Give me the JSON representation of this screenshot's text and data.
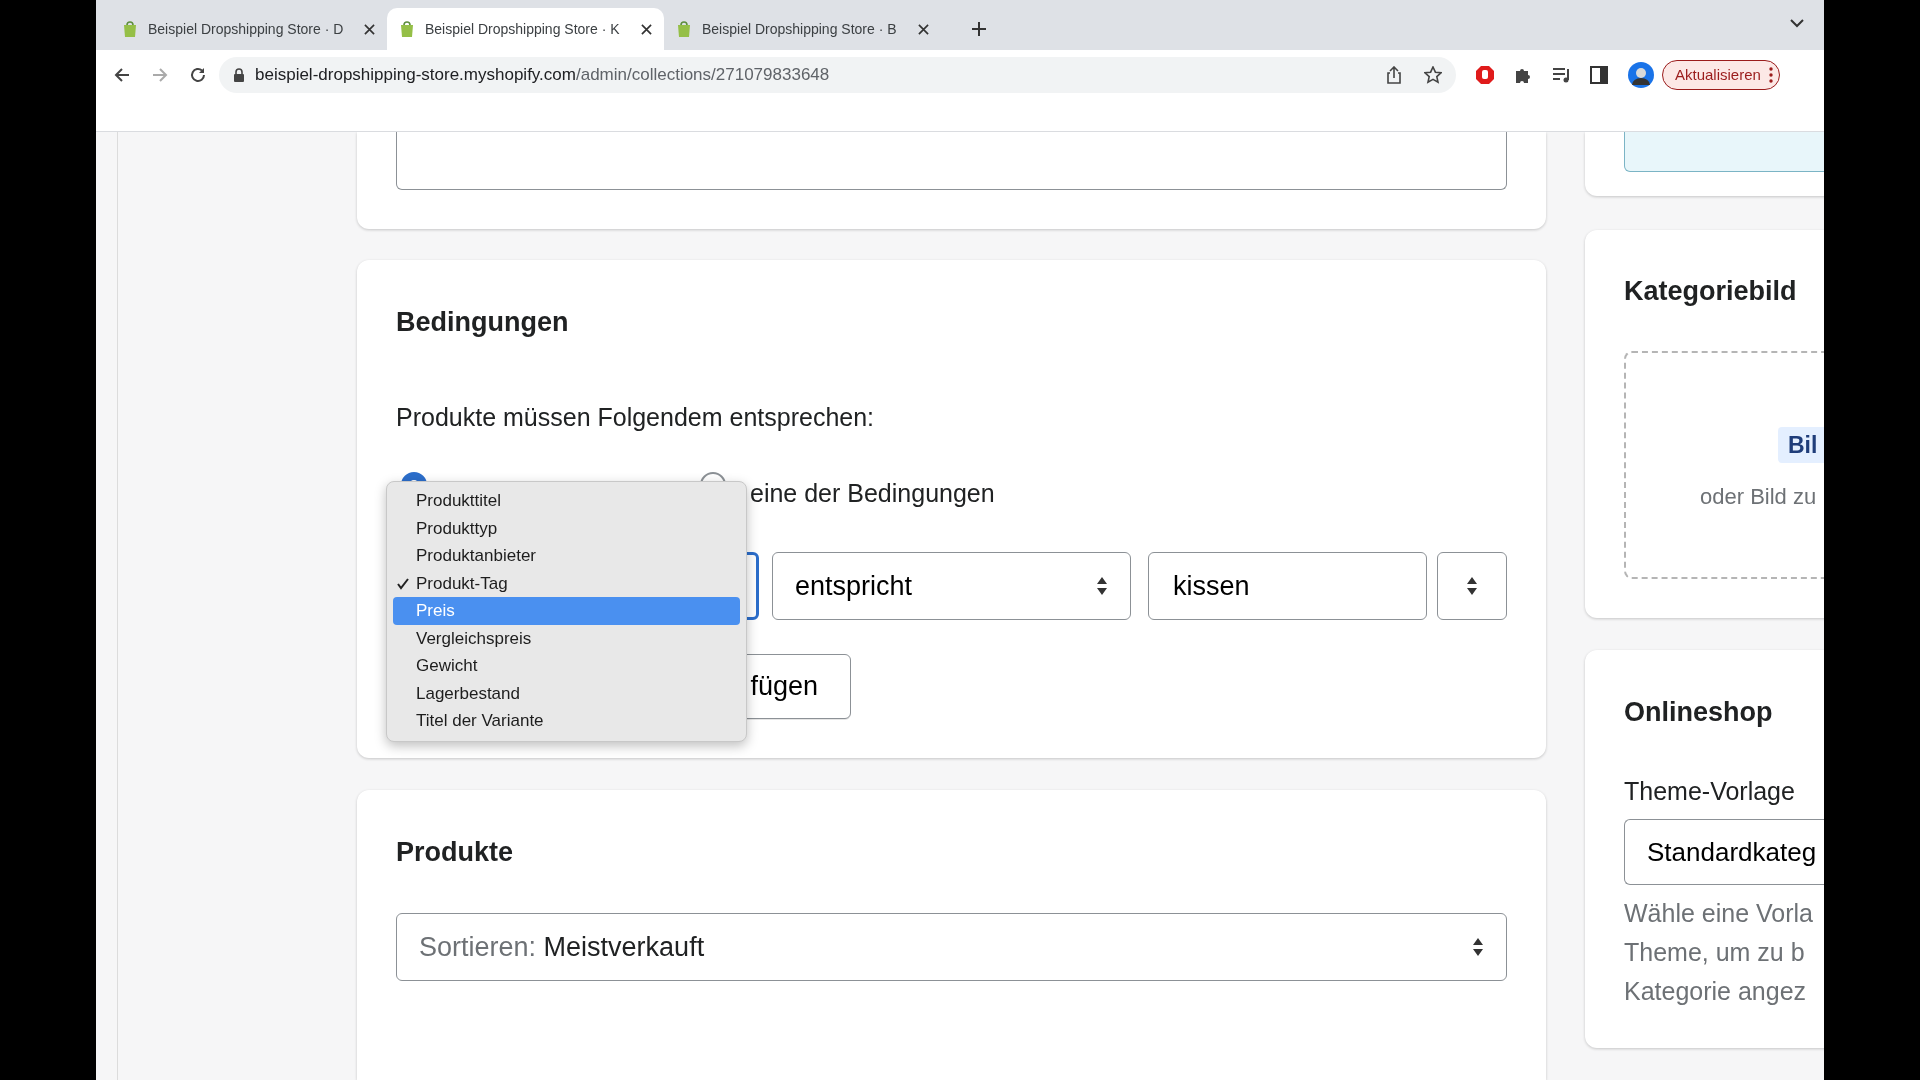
{
  "browser": {
    "tabs": [
      {
        "title": "Beispiel Dropshipping Store · D",
        "selected": false
      },
      {
        "title": "Beispiel Dropshipping Store · K",
        "selected": true
      },
      {
        "title": "Beispiel Dropshipping Store · B",
        "selected": false
      }
    ],
    "url": {
      "host": "beispiel-dropshipping-store.myshopify.com",
      "path": "/admin/collections/271079833648"
    },
    "update_button": "Aktualisieren"
  },
  "conditions": {
    "title": "Bedingungen",
    "intro": "Produkte müssen Folgendem entsprechen:",
    "radios": [
      {
        "selected": true
      },
      {
        "label": "eine der Bedingungen",
        "selected": false
      }
    ],
    "rule": {
      "operator": "entspricht",
      "value": "kissen"
    },
    "add_button": "fügen",
    "menu": [
      {
        "label": "Produkttitel",
        "checked": false,
        "selected": false
      },
      {
        "label": "Produkttyp",
        "checked": false,
        "selected": false
      },
      {
        "label": "Produktanbieter",
        "checked": false,
        "selected": false
      },
      {
        "label": "Produkt-Tag",
        "checked": true,
        "selected": false
      },
      {
        "label": "Preis",
        "checked": false,
        "selected": true
      },
      {
        "label": "Vergleichspreis",
        "checked": false,
        "selected": false
      },
      {
        "label": "Gewicht",
        "checked": false,
        "selected": false
      },
      {
        "label": "Lagerbestand",
        "checked": false,
        "selected": false
      },
      {
        "label": "Titel der Variante",
        "checked": false,
        "selected": false
      }
    ]
  },
  "products": {
    "title": "Produkte",
    "sort_label": "Sortieren:",
    "sort_value": "Meistverkauft"
  },
  "category_image": {
    "title": "Kategoriebild",
    "button": "Bil",
    "hint": "oder Bild zu"
  },
  "online_store": {
    "title": "Onlineshop",
    "template_label": "Theme-Vorlage",
    "template_value": "Standardkateg",
    "help": [
      "Wähle eine Vorla",
      "Theme, um zu b",
      "Kategorie angez"
    ]
  }
}
